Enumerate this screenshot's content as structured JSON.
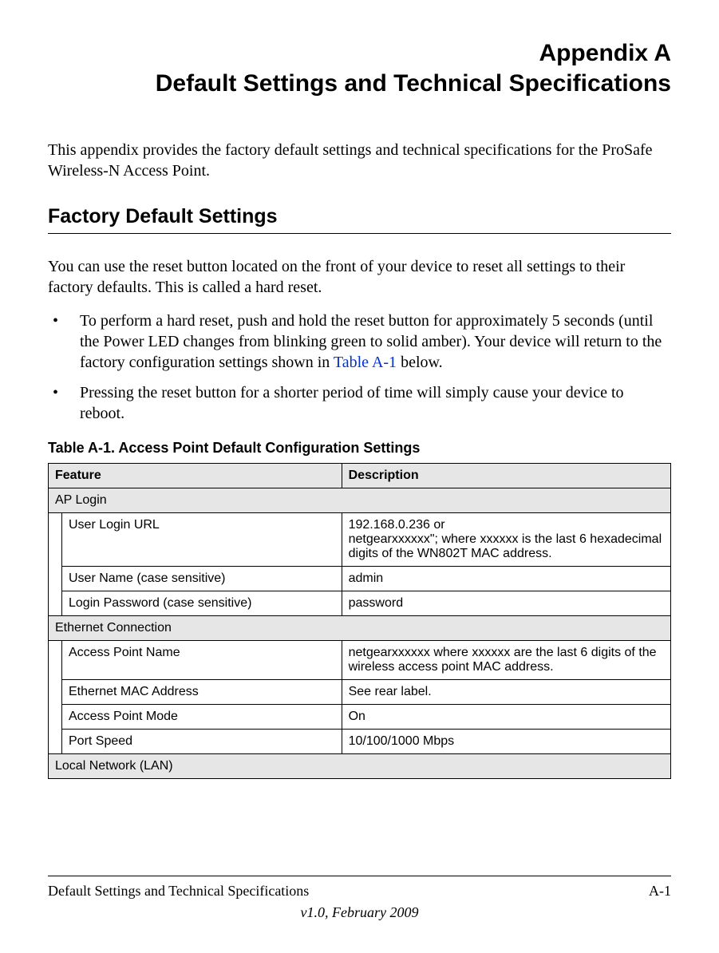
{
  "title": {
    "appendix": "Appendix A",
    "main": "Default Settings and Technical Specifications"
  },
  "intro": "This appendix provides the factory default settings and technical specifications for the ProSafe Wireless-N Access Point.",
  "section_heading": "Factory Default Settings",
  "body_para": "You can use the reset button located on the front of your device to reset all settings to their factory defaults. This is called a hard reset.",
  "bullets": [
    {
      "pre": "To perform a hard reset, push and hold the reset button for approximately 5 seconds (until the Power LED changes from blinking green to solid amber). Your device will return to the factory configuration settings shown in ",
      "link": "Table A-1",
      "post": " below."
    },
    {
      "pre": "Pressing the reset button for a shorter period of time will simply cause your device to reboot.",
      "link": "",
      "post": ""
    }
  ],
  "table": {
    "caption": "Table A-1.  Access Point Default Configuration Settings",
    "headers": {
      "feature": "Feature",
      "description": "Description"
    },
    "sections": [
      {
        "name": "AP Login",
        "rows": [
          {
            "feature": "User Login URL",
            "description": "192.168.0.236 or\nnetgearxxxxxx\"; where xxxxxx is the last 6 hexadecimal digits of the WN802T MAC address."
          },
          {
            "feature": "User Name (case sensitive)",
            "description": "admin"
          },
          {
            "feature": "Login Password (case sensitive)",
            "description": "password"
          }
        ]
      },
      {
        "name": "Ethernet Connection",
        "rows": [
          {
            "feature": "Access Point Name",
            "description": "netgearxxxxxx where xxxxxx are the last 6 digits of the wireless access point MAC address."
          },
          {
            "feature": "Ethernet MAC Address",
            "description": "See rear label."
          },
          {
            "feature": "Access Point Mode",
            "description": "On"
          },
          {
            "feature": "Port Speed",
            "description": "10/100/1000 Mbps"
          }
        ]
      },
      {
        "name": "Local Network (LAN)",
        "rows": []
      }
    ]
  },
  "footer": {
    "left": "Default Settings and Technical Specifications",
    "right": "A-1",
    "version": "v1.0, February 2009"
  }
}
